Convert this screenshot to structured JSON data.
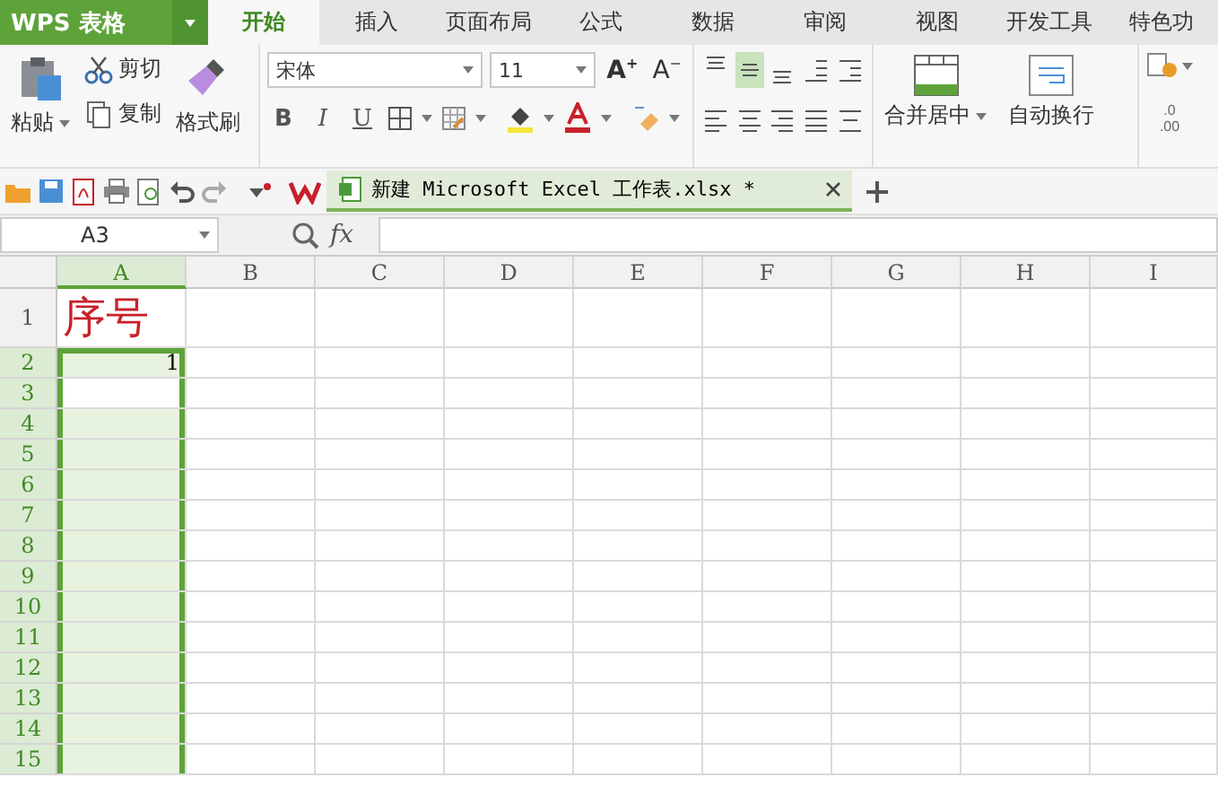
{
  "app_menu": {
    "label": "WPS 表格"
  },
  "tabs": [
    {
      "label": "开始",
      "selected": true
    },
    {
      "label": "插入",
      "selected": false
    },
    {
      "label": "页面布局",
      "selected": false
    },
    {
      "label": "公式",
      "selected": false
    },
    {
      "label": "数据",
      "selected": false
    },
    {
      "label": "审阅",
      "selected": false
    },
    {
      "label": "视图",
      "selected": false
    },
    {
      "label": "开发工具",
      "selected": false
    },
    {
      "label": "特色功",
      "selected": false
    }
  ],
  "clipboard": {
    "paste": "粘贴",
    "cut": "剪切",
    "copy": "复制",
    "format_painter": "格式刷"
  },
  "font": {
    "name": "宋体",
    "size": "11",
    "grow": "A",
    "grow_sign": "+",
    "shrink": "A",
    "shrink_sign": "−",
    "styles": [
      {
        "label": "B",
        "kind": "bold"
      },
      {
        "label": "I",
        "kind": "italic"
      },
      {
        "label": "U",
        "kind": "underline"
      }
    ]
  },
  "alignment": {
    "top_row": [
      {
        "selected": false
      },
      {
        "selected": true
      },
      {
        "selected": false
      }
    ]
  },
  "merge": {
    "merge_center": "合并居中",
    "wrap_text": "自动换行"
  },
  "number": {
    "decimal_top": ".0",
    "decimal_bottom": ".00"
  },
  "document_tab": {
    "title": "新建 Microsoft Excel 工作表.xlsx *",
    "selected": true
  },
  "name_box": "A3",
  "fx_label": "fx",
  "columns": [
    {
      "label": "A",
      "selected": true
    },
    {
      "label": "B",
      "selected": false
    },
    {
      "label": "C",
      "selected": false
    },
    {
      "label": "D",
      "selected": false
    },
    {
      "label": "E",
      "selected": false
    },
    {
      "label": "F",
      "selected": false
    },
    {
      "label": "G",
      "selected": false
    },
    {
      "label": "H",
      "selected": false
    },
    {
      "label": "I",
      "selected": false
    }
  ],
  "rows": [
    {
      "label": "1",
      "selected": false,
      "active": false,
      "cells": [
        {
          "text": "序号",
          "kind": "title"
        }
      ]
    },
    {
      "label": "2",
      "selected": true,
      "active": false,
      "cells": [
        {
          "text": "1",
          "kind": "number"
        }
      ]
    },
    {
      "label": "3",
      "selected": true,
      "active": true,
      "cells": []
    },
    {
      "label": "4",
      "selected": true,
      "active": false,
      "cells": []
    },
    {
      "label": "5",
      "selected": true,
      "active": false,
      "cells": []
    },
    {
      "label": "6",
      "selected": true,
      "active": false,
      "cells": []
    },
    {
      "label": "7",
      "selected": true,
      "active": false,
      "cells": []
    },
    {
      "label": "8",
      "selected": true,
      "active": false,
      "cells": []
    },
    {
      "label": "9",
      "selected": true,
      "active": false,
      "cells": []
    },
    {
      "label": "10",
      "selected": true,
      "active": false,
      "cells": []
    },
    {
      "label": "11",
      "selected": true,
      "active": false,
      "cells": []
    },
    {
      "label": "12",
      "selected": true,
      "active": false,
      "cells": []
    },
    {
      "label": "13",
      "selected": true,
      "active": false,
      "cells": []
    },
    {
      "label": "14",
      "selected": true,
      "active": false,
      "cells": []
    },
    {
      "label": "15",
      "selected": true,
      "active": false,
      "cells": []
    }
  ]
}
